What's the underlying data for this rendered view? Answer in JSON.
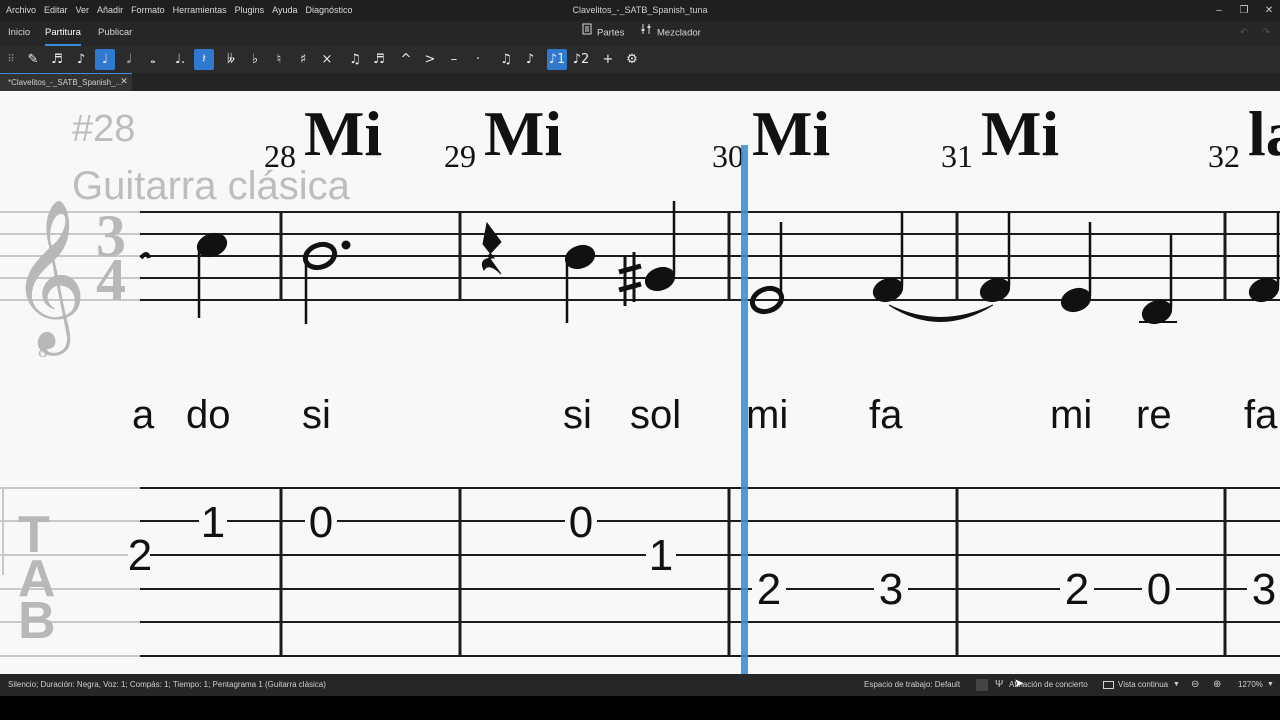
{
  "menu": [
    "Archivo",
    "Editar",
    "Ver",
    "Añadir",
    "Formato",
    "Herramientas",
    "Plugins",
    "Ayuda",
    "Diagnóstico"
  ],
  "window_title": "Clavelitos_-_SATB_Spanish_tuna",
  "tabs": {
    "inicio": "Inicio",
    "partitura": "Partitura",
    "publicar": "Publicar",
    "partes": "Partes",
    "mezclador": "Mezclador"
  },
  "document_tab": "*Clavelitos_-_SATB_Spanish_...",
  "toolbar": [
    {
      "name": "note-input-icon",
      "glyph": "✎"
    },
    {
      "name": "sixteenth-note-icon",
      "glyph": "♬"
    },
    {
      "name": "eighth-note-icon",
      "glyph": "♪"
    },
    {
      "name": "quarter-note-icon",
      "glyph": "♩",
      "active": true
    },
    {
      "name": "half-note-icon",
      "glyph": "𝅗𝅥"
    },
    {
      "name": "whole-note-icon",
      "glyph": "𝅝"
    },
    {
      "name": "augmentation-dot-icon",
      "glyph": "♩."
    },
    {
      "name": "rest-icon",
      "glyph": "𝄽",
      "active": true
    },
    {
      "name": "double-flat-icon",
      "glyph": "𝄫"
    },
    {
      "name": "flat-icon",
      "glyph": "♭"
    },
    {
      "name": "natural-icon",
      "glyph": "♮"
    },
    {
      "name": "sharp-icon",
      "glyph": "♯"
    },
    {
      "name": "double-sharp-icon",
      "glyph": "×"
    },
    {
      "name": "tie-icon",
      "glyph": "♫"
    },
    {
      "name": "slur-icon",
      "glyph": "♬"
    },
    {
      "name": "marcato-icon",
      "glyph": "^"
    },
    {
      "name": "accent-icon",
      "glyph": ">"
    },
    {
      "name": "tenuto-icon",
      "glyph": "–"
    },
    {
      "name": "staccato-icon",
      "glyph": "·"
    },
    {
      "name": "tuplet-icon",
      "glyph": "♫"
    },
    {
      "name": "flip-direction-icon",
      "glyph": "♪"
    },
    {
      "name": "voice-1-icon",
      "glyph": "♪1",
      "active": true
    },
    {
      "name": "voice-2-icon",
      "glyph": "♪2"
    },
    {
      "name": "add-icon",
      "glyph": "+"
    },
    {
      "name": "customize-icon",
      "glyph": "⚙"
    }
  ],
  "score": {
    "rehearsal": "#28",
    "instrument": "Guitarra clásica",
    "time_signature": [
      "3",
      "4"
    ],
    "tab_letters": [
      "T",
      "A",
      "B"
    ],
    "measures": [
      {
        "number": "28",
        "chord": "Mi"
      },
      {
        "number": "29",
        "chord": "Mi"
      },
      {
        "number": "30",
        "chord": "Mi"
      },
      {
        "number": "31",
        "chord": "Mi"
      },
      {
        "number": "32",
        "chord": "la"
      }
    ],
    "lyrics": [
      "a",
      "do",
      "si",
      "si",
      "sol",
      "mi",
      "fa",
      "mi",
      "re",
      "fa"
    ],
    "tab_numbers": [
      "2",
      "1",
      "0",
      "0",
      "1",
      "2",
      "3",
      "2",
      "0",
      "3"
    ]
  },
  "status": {
    "text": "Silencio; Duración: Negra, Voz: 1; Compás: 1; Tiempo: 1; Pentagrama 1 (Guitarra clásica)",
    "workspace": "Espacio de trabajo: Default",
    "concert_pitch": "Afinación de concierto",
    "view_mode": "Vista continua",
    "zoom": "1270%"
  }
}
